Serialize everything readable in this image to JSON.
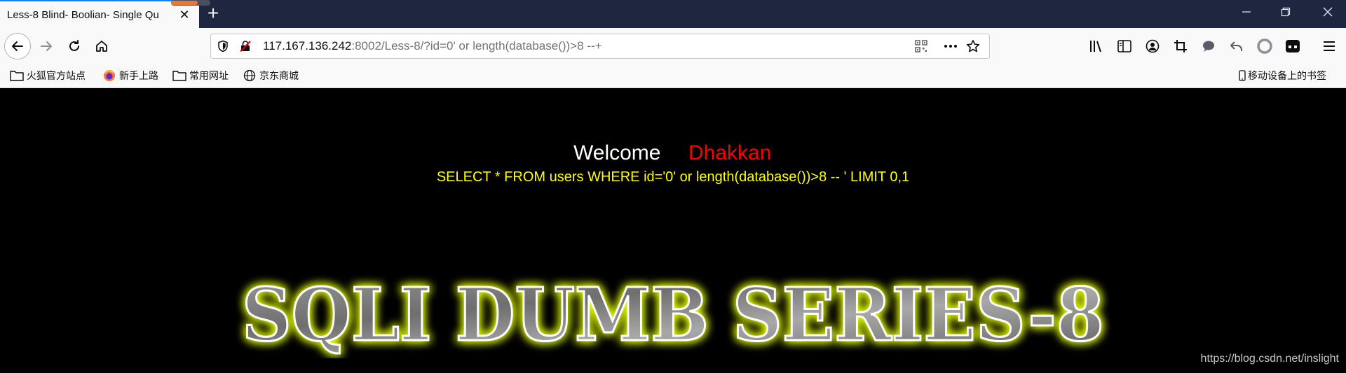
{
  "tab": {
    "title": "Less-8 Blind- Boolian- Single Qu",
    "close_symbol": "✕",
    "new_tab_symbol": "+"
  },
  "window_controls": {
    "minimize": "—",
    "restore": "❐",
    "close": "✕"
  },
  "url": {
    "host": "117.167.136.242",
    "rest": ":8002/Less-8/?id=0' or length(database())>8 --+"
  },
  "icons": {
    "back": "back-arrow-icon",
    "forward": "forward-arrow-icon",
    "reload": "reload-icon",
    "home": "home-icon",
    "tracking": "shield-icon",
    "insecure": "insecure-lock-icon",
    "qr": "qr-code-icon",
    "more": "more-icon",
    "bookmark": "star-icon",
    "library": "library-icon",
    "sidebar": "sidebar-icon",
    "account": "account-icon",
    "screenshot": "crop-icon",
    "chat": "chat-icon",
    "undo": "undo-icon",
    "circle": "circle-icon",
    "extension": "extension-icon",
    "menu": "hamburger-menu-icon"
  },
  "bookmarks": {
    "items": [
      {
        "label": "火狐官方站点",
        "icon": "folder-icon"
      },
      {
        "label": "新手上路",
        "icon": "firefox-icon"
      },
      {
        "label": "常用网址",
        "icon": "folder-icon"
      },
      {
        "label": "京东商城",
        "icon": "globe-icon"
      }
    ],
    "mobile": {
      "label": "移动设备上的书签",
      "icon": "mobile-icon"
    }
  },
  "page": {
    "welcome": "Welcome",
    "username": "Dhakkan",
    "query": "SELECT * FROM users WHERE id='0' or length(database())>8 -- ' LIMIT 0,1",
    "banner": "SQLI DUMB SERIES-8",
    "watermark": "https://blog.csdn.net/inslight"
  },
  "colors": {
    "accent_tab": "#0a84ff",
    "query_text": "#ffff00",
    "username_text": "#ff0000",
    "banner_glow": "#e5ff00"
  }
}
